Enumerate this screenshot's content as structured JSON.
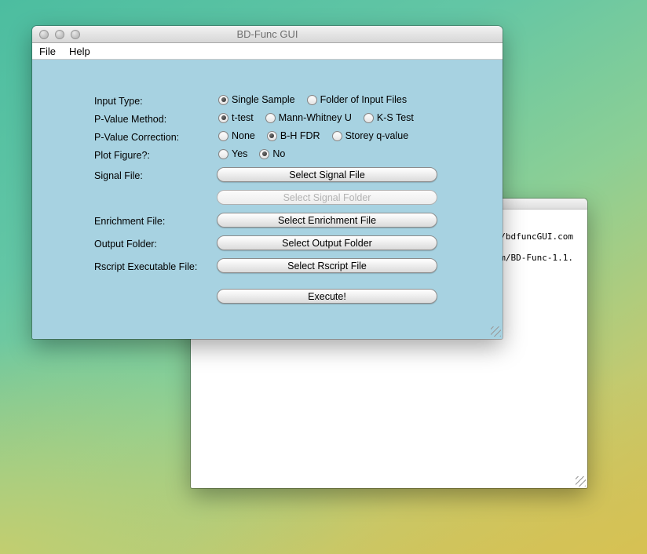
{
  "main_window": {
    "title": "BD-Func GUI",
    "menu": {
      "file": "File",
      "help": "Help"
    },
    "content_bg": "#a7d2e1",
    "rows": {
      "input_type": {
        "label": "Input Type:",
        "options": [
          {
            "label": "Single Sample",
            "selected": true
          },
          {
            "label": "Folder of Input Files",
            "selected": false
          }
        ]
      },
      "pvalue_method": {
        "label": "P-Value Method:",
        "options": [
          {
            "label": "t-test",
            "selected": true
          },
          {
            "label": "Mann-Whitney U",
            "selected": false
          },
          {
            "label": "K-S Test",
            "selected": false
          }
        ]
      },
      "pvalue_correction": {
        "label": "P-Value Correction:",
        "options": [
          {
            "label": "None",
            "selected": false
          },
          {
            "label": "B-H FDR",
            "selected": true
          },
          {
            "label": "Storey q-value",
            "selected": false
          }
        ]
      },
      "plot_figure": {
        "label": "Plot Figure?:",
        "options": [
          {
            "label": "Yes",
            "selected": false
          },
          {
            "label": "No",
            "selected": true
          }
        ]
      },
      "signal_file": {
        "label": "Signal File:",
        "button": "Select Signal File"
      },
      "signal_folder": {
        "button": "Select Signal Folder",
        "disabled": true
      },
      "enrichment_file": {
        "label": "Enrichment File:",
        "button": "Select Enrichment File"
      },
      "output_folder": {
        "label": "Output Folder:",
        "button": "Select Output Folder"
      },
      "rscript": {
        "label": "Rscript Executable File:",
        "button": "Select Rscript File"
      },
      "execute": {
        "button": "Execute!"
      }
    }
  },
  "background_window": {
    "line1": "n/bdfuncGUI.com",
    "line2": "mm/BD-Func-1.1."
  }
}
